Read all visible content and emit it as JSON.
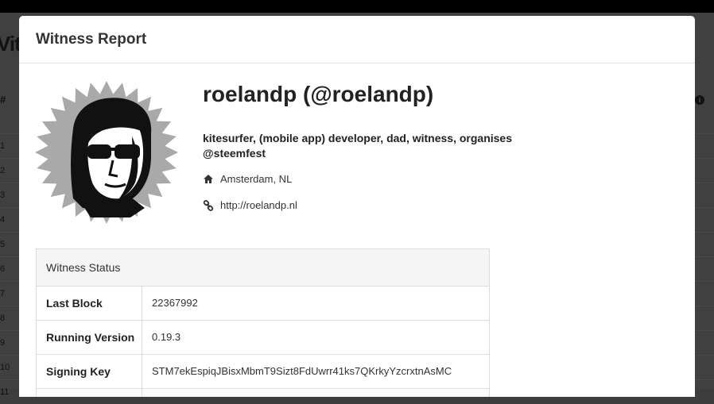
{
  "background": {
    "title_fragment": "Vit",
    "rank_header": "#",
    "rank_numbers": [
      "1",
      "2",
      "3",
      "4",
      "5",
      "6",
      "7",
      "8",
      "9",
      "10",
      "11"
    ]
  },
  "modal": {
    "title": "Witness Report",
    "profile": {
      "name": "roelandp (@roelandp)",
      "about": "kitesurfer, (mobile app) developer, dad, witness, organises @steemfest",
      "location": "Amsterdam, NL",
      "website": "http://roelandp.nl",
      "location_icon": "home-icon",
      "website_icon": "link-icon"
    },
    "witness_status": {
      "heading": "Witness Status",
      "rows": [
        {
          "label": "Last Block",
          "value": "22367992"
        },
        {
          "label": "Running Version",
          "value": "0.19.3"
        },
        {
          "label": "Signing Key",
          "value": "STM7ekEspiqJBisxMbmT9Sizt8FdUwrr41ks7QKrkyYzcrxtnAsMC"
        }
      ]
    }
  }
}
